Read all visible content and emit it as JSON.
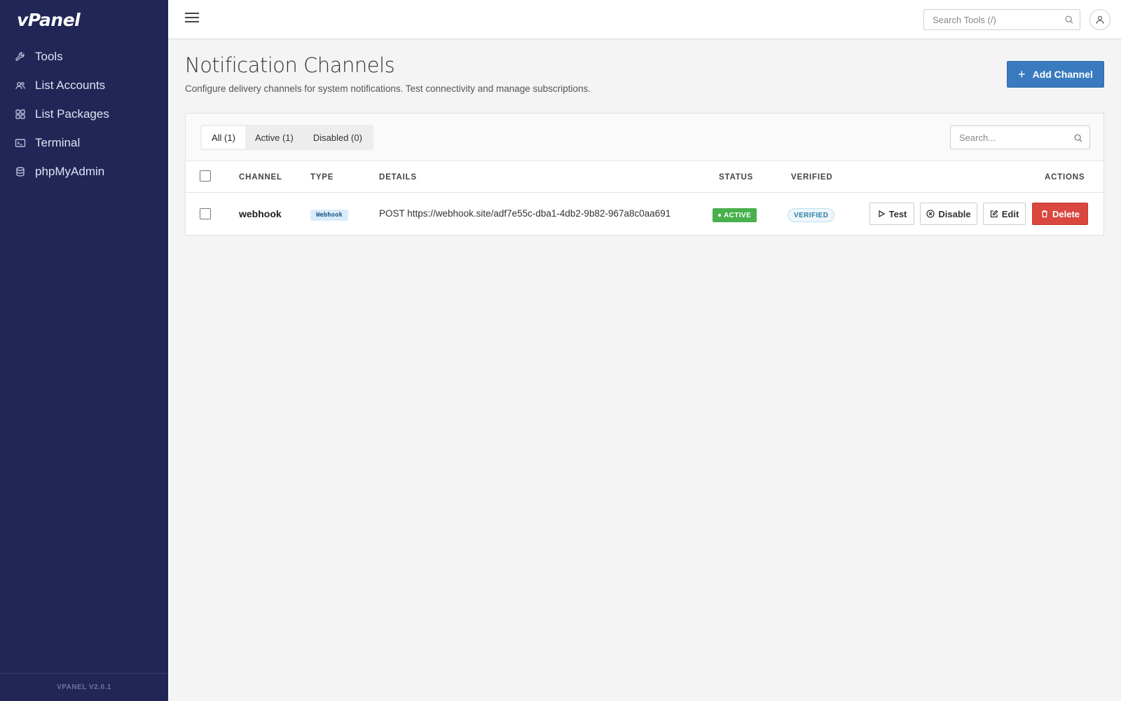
{
  "app": {
    "logo": "vPanel",
    "version": "VPANEL V2.0.1"
  },
  "sidebar": {
    "items": [
      {
        "label": "Tools",
        "icon": "wrench-icon"
      },
      {
        "label": "List Accounts",
        "icon": "users-icon"
      },
      {
        "label": "List Packages",
        "icon": "grid-icon"
      },
      {
        "label": "Terminal",
        "icon": "terminal-icon"
      },
      {
        "label": "phpMyAdmin",
        "icon": "database-icon"
      }
    ]
  },
  "topbar": {
    "search_placeholder": "Search Tools (/)"
  },
  "page": {
    "title": "Notification Channels",
    "subtitle": "Configure delivery channels for system notifications. Test connectivity and manage subscriptions.",
    "add_button": "Add Channel"
  },
  "tabs": [
    {
      "label": "All (1)",
      "active": true
    },
    {
      "label": "Active (1)",
      "active": false
    },
    {
      "label": "Disabled (0)",
      "active": false
    }
  ],
  "table": {
    "search_placeholder": "Search...",
    "columns": [
      "CHANNEL",
      "TYPE",
      "DETAILS",
      "STATUS",
      "VERIFIED",
      "ACTIONS"
    ],
    "rows": [
      {
        "channel": "webhook",
        "type": "Webhook",
        "details": "POST https://webhook.site/adf7e55c-dba1-4db2-9b82-967a8c0aa691",
        "status": "ACTIVE",
        "verified": "VERIFIED",
        "actions": {
          "test": "Test",
          "disable": "Disable",
          "edit": "Edit",
          "delete": "Delete"
        }
      }
    ]
  },
  "colors": {
    "sidebar_bg": "#212656",
    "primary": "#3a7bc0",
    "success": "#48b04c",
    "danger": "#d9473f"
  }
}
